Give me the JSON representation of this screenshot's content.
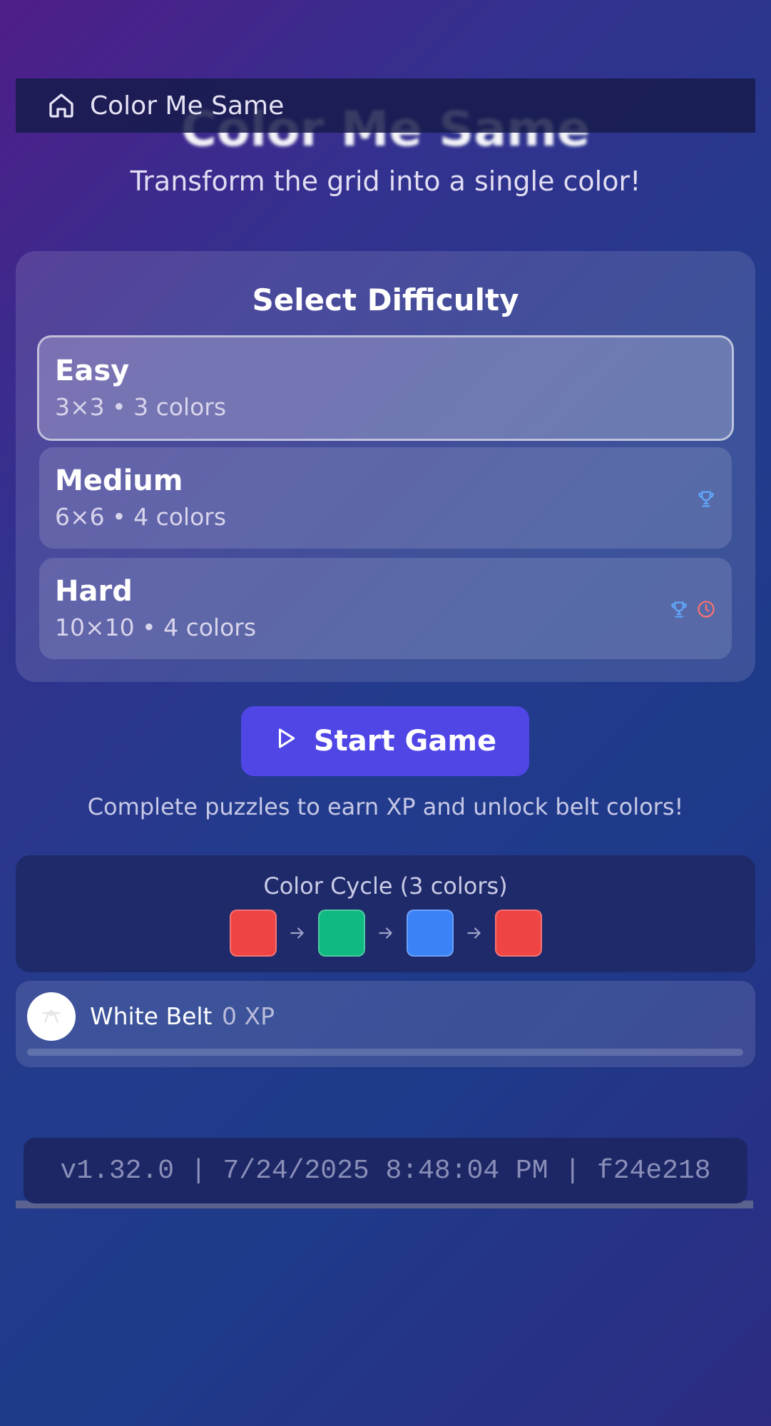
{
  "nav": {
    "title": "Color Me Same",
    "icon": "home-icon"
  },
  "hero": {
    "title": "Color Me Same",
    "subtitle": "Transform the grid into a single color!"
  },
  "difficulty": {
    "heading": "Select Difficulty",
    "options": [
      {
        "name": "Easy",
        "desc": "3×3 • 3 colors",
        "selected": true,
        "badges": []
      },
      {
        "name": "Medium",
        "desc": "6×6 • 4 colors",
        "selected": false,
        "badges": [
          "trophy-icon"
        ]
      },
      {
        "name": "Hard",
        "desc": "10×10 • 4 colors",
        "selected": false,
        "badges": [
          "trophy-icon",
          "clock-icon"
        ]
      }
    ]
  },
  "start_button": {
    "label": "Start Game",
    "icon": "play-icon"
  },
  "hint": "Complete puzzles to earn XP and unlock belt colors!",
  "color_cycle": {
    "title": "Color Cycle (3 colors)",
    "colors": [
      "#ef4444",
      "#10b981",
      "#3b82f6",
      "#ef4444"
    ]
  },
  "belt": {
    "name": "White Belt",
    "xp": "0 XP",
    "progress": 0
  },
  "version": "v1.32.0 | 7/24/2025 8:48:04 PM | f24e218",
  "colors": {
    "accent": "#4f46e5",
    "trophy": "#60a5fa",
    "clock": "#f87171"
  }
}
